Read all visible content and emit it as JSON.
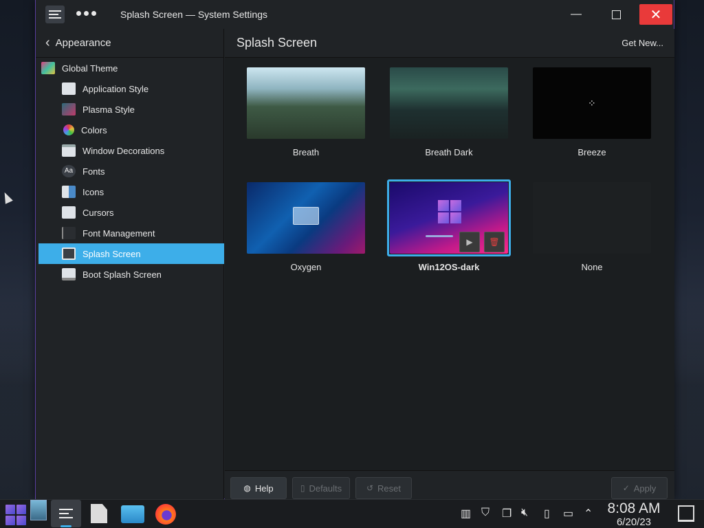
{
  "window": {
    "title": "Splash Screen — System Settings"
  },
  "sidebar": {
    "back_label": "Appearance",
    "items": [
      {
        "label": "Global Theme",
        "icon": "global-theme-icon",
        "color": "#e04080"
      },
      {
        "label": "Application Style",
        "icon": "application-style-icon",
        "color": "#dfe3e8"
      },
      {
        "label": "Plasma Style",
        "icon": "plasma-style-icon",
        "color": "#3a8a9a"
      },
      {
        "label": "Colors",
        "icon": "colors-icon",
        "color": "#c040c0"
      },
      {
        "label": "Window Decorations",
        "icon": "window-decorations-icon",
        "color": "#dfe3e8"
      },
      {
        "label": "Fonts",
        "icon": "fonts-icon",
        "color": "#3a3f46"
      },
      {
        "label": "Icons",
        "icon": "icons-icon",
        "color": "#dfe3e8"
      },
      {
        "label": "Cursors",
        "icon": "cursors-icon",
        "color": "#dfe3e8"
      },
      {
        "label": "Font Management",
        "icon": "font-management-icon",
        "color": "#2a2d31"
      },
      {
        "label": "Splash Screen",
        "icon": "splash-screen-icon",
        "color": "#3a3f46",
        "active": true
      },
      {
        "label": "Boot Splash Screen",
        "icon": "boot-splash-screen-icon",
        "color": "#dfe3e8"
      }
    ]
  },
  "main": {
    "title": "Splash Screen",
    "get_new": "Get New...",
    "themes": [
      {
        "label": "Breath"
      },
      {
        "label": "Breath Dark"
      },
      {
        "label": "Breeze"
      },
      {
        "label": "Oxygen"
      },
      {
        "label": "Win12OS-dark",
        "selected": true
      },
      {
        "label": "None"
      }
    ]
  },
  "footer": {
    "help": "Help",
    "defaults": "Defaults",
    "reset": "Reset",
    "apply": "Apply"
  },
  "taskbar": {
    "time": "8:08 AM",
    "date": "6/20/23"
  }
}
